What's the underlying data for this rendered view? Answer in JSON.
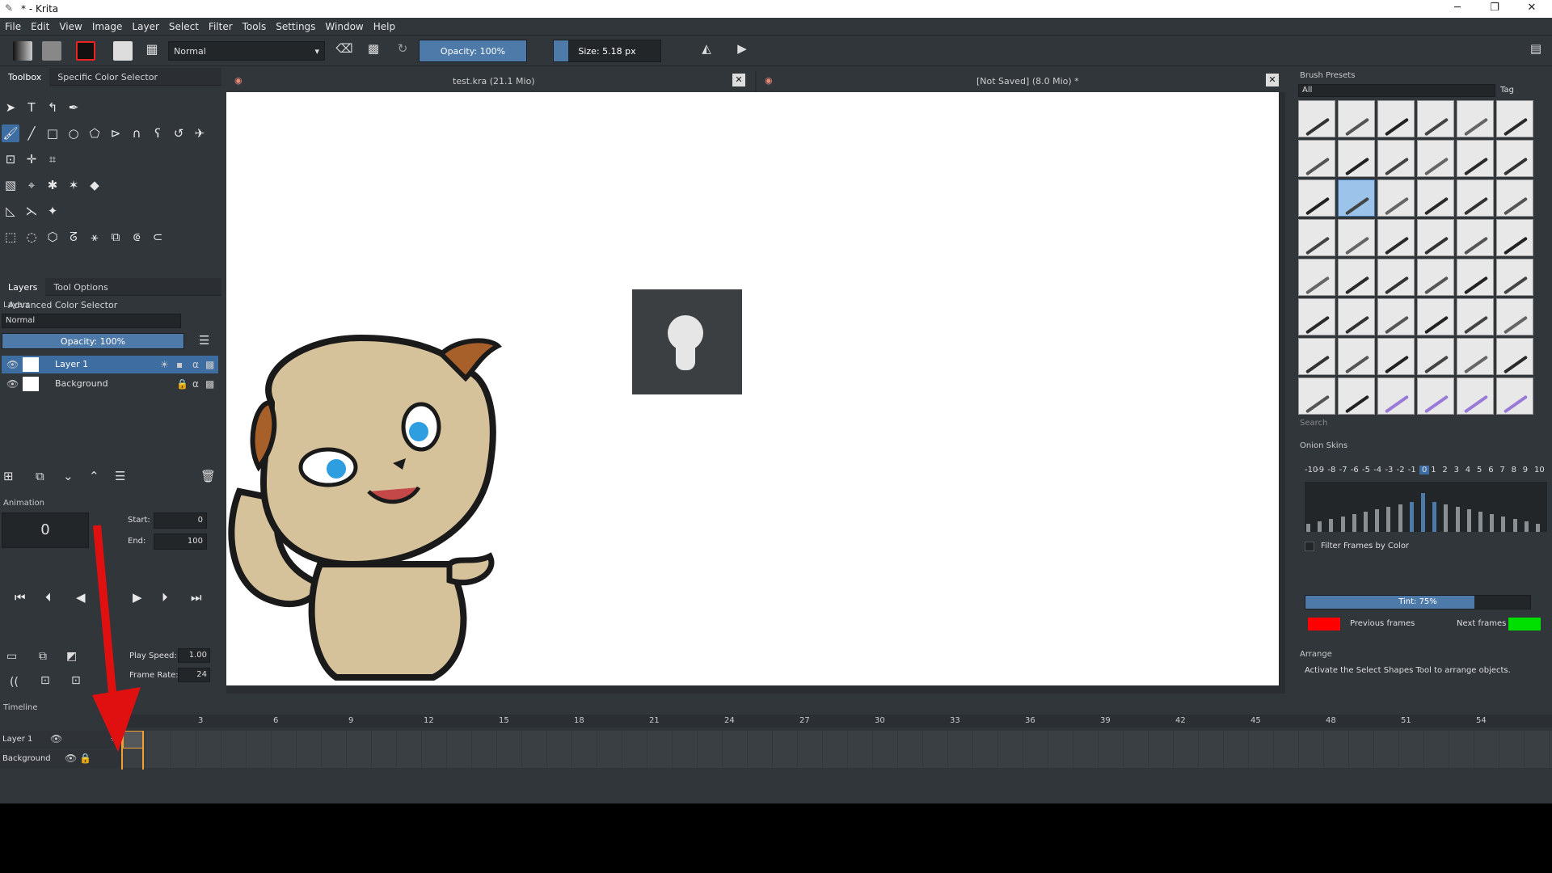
{
  "window": {
    "title": "* - Krita",
    "minimize": "─",
    "restore": "❐",
    "close": "✕"
  },
  "menu": [
    "File",
    "Edit",
    "View",
    "Image",
    "Layer",
    "Select",
    "Filter",
    "Tools",
    "Settings",
    "Window",
    "Help"
  ],
  "toolbar": {
    "blend_mode": "Normal",
    "opacity": "Opacity: 100%",
    "opacity_value": 1.0,
    "size": "Size: 5.18 px"
  },
  "left_top_tabs": [
    "Toolbox",
    "Specific Color Selector"
  ],
  "left_mid_tabs": [
    "Layers",
    "Tool Options",
    "Advanced Color Selector"
  ],
  "layers": {
    "title": "Layers",
    "blend_mode": "Normal",
    "opacity": "Opacity: 100%",
    "items": [
      {
        "name": "Layer 1",
        "selected": true
      },
      {
        "name": "Background",
        "selected": false
      }
    ]
  },
  "animation": {
    "title": "Animation",
    "frame": "0",
    "start_label": "Start:",
    "start": "0",
    "end_label": "End:",
    "end": "100",
    "play_speed_label": "Play Speed:",
    "play_speed": "1.00",
    "frame_rate_label": "Frame Rate:",
    "frame_rate": "24"
  },
  "documents": [
    {
      "title": "test.kra (21.1 Mio)"
    },
    {
      "title": "[Not Saved]  (8.0 Mio) *"
    }
  ],
  "brush_presets": {
    "title": "Brush Presets",
    "filter": "All",
    "tag": "Tag",
    "search_placeholder": "Search"
  },
  "onion_skins": {
    "title": "Onion Skins",
    "numbers": [
      "-10",
      "-9",
      "-8",
      "-7",
      "-6",
      "-5",
      "-4",
      "-3",
      "-2",
      "-1",
      "0",
      "1",
      "2",
      "3",
      "4",
      "5",
      "6",
      "7",
      "8",
      "9",
      "10"
    ],
    "filter_label": "Filter Frames by Color",
    "tint": "Tint: 75%",
    "tint_value": 0.75,
    "previous_label": "Previous frames",
    "next_label": "Next frames",
    "previous_color": "#ff0000",
    "next_color": "#00e000"
  },
  "arrange": {
    "title": "Arrange",
    "message": "Activate the Select Shapes Tool to arrange objects."
  },
  "timeline": {
    "title": "Timeline",
    "ticks": [
      "0",
      "3",
      "6",
      "9",
      "12",
      "15",
      "18",
      "21",
      "24",
      "27",
      "30",
      "33",
      "36",
      "39",
      "42",
      "45",
      "48",
      "51",
      "54"
    ],
    "layers": [
      "Layer 1",
      "Background"
    ]
  },
  "colors": {
    "accent": "#3d6da1",
    "annotation_arrow": "#e01010",
    "playhead": "#f0a030"
  }
}
